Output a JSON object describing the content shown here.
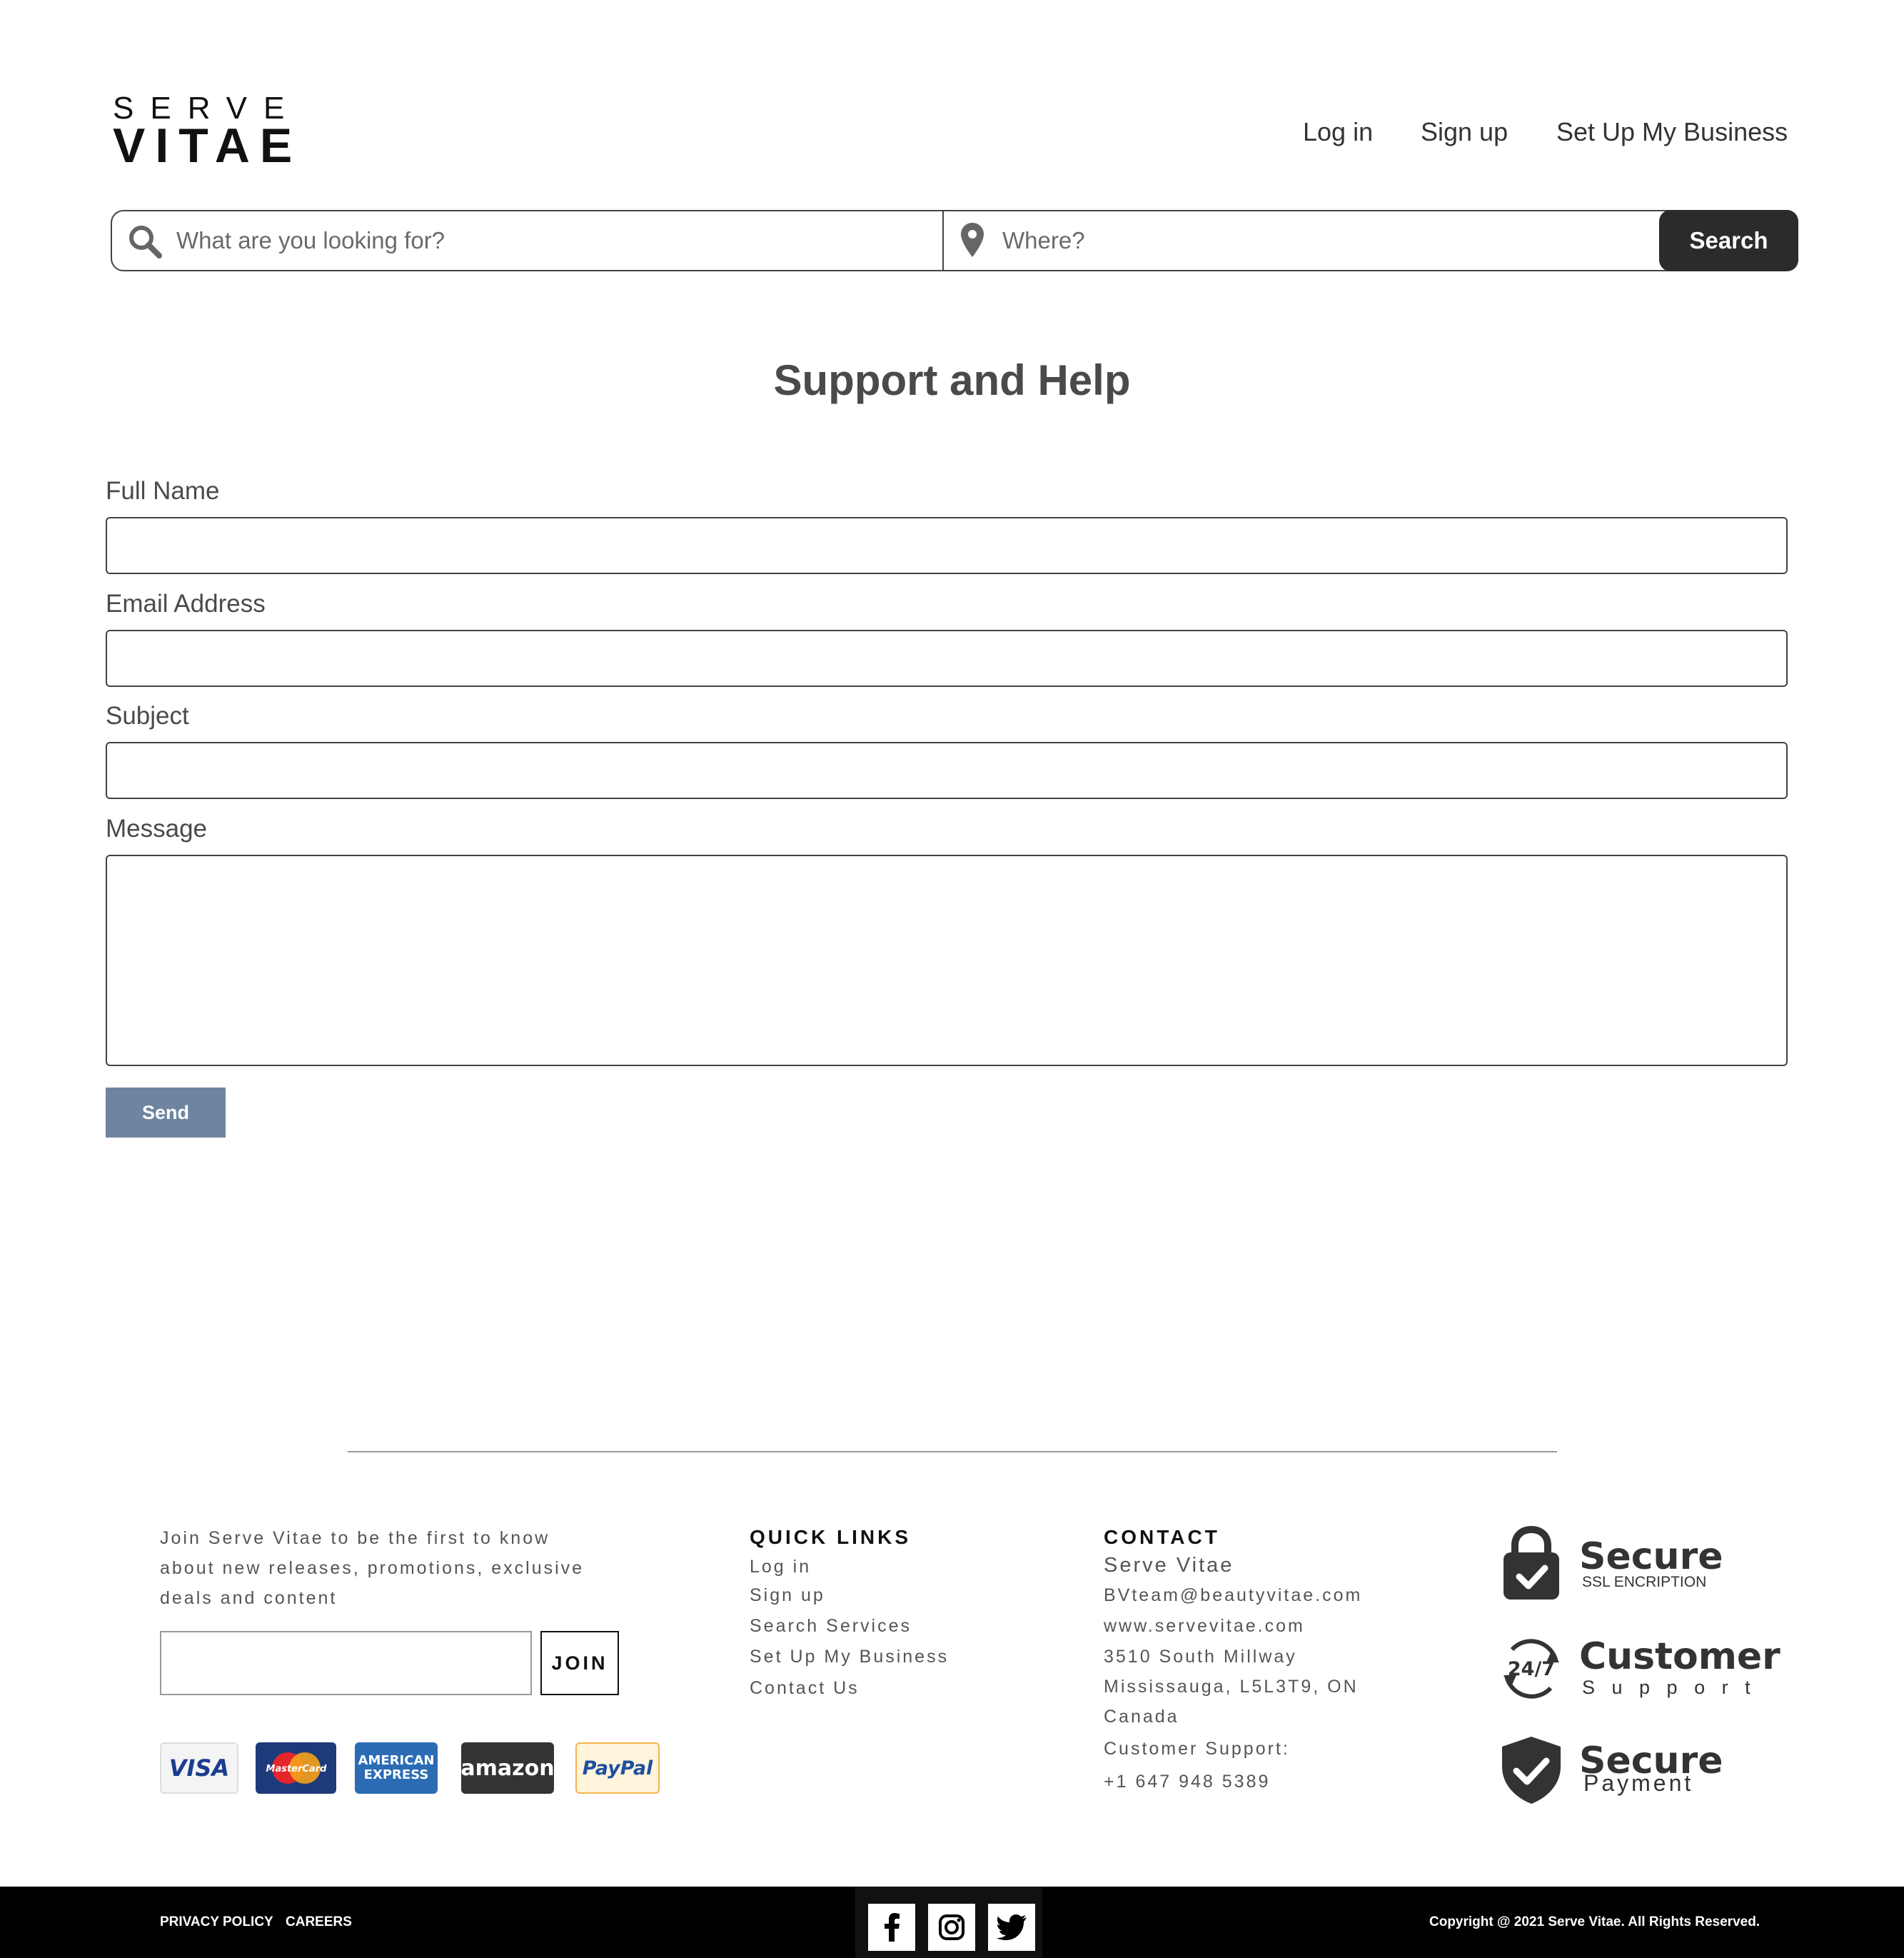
{
  "header": {
    "logo_top": "SERVE",
    "logo_bottom": "VITAE",
    "nav": {
      "login": "Log in",
      "signup": "Sign up",
      "business": "Set Up My Business"
    }
  },
  "search": {
    "what_placeholder": "What are you looking for?",
    "where_placeholder": "Where?",
    "button": "Search"
  },
  "page_title": "Support and Help",
  "form": {
    "full_name_label": "Full Name",
    "full_name_value": "",
    "email_label": "Email Address",
    "email_value": "",
    "subject_label": "Subject",
    "subject_value": "",
    "message_label": "Message",
    "message_value": "",
    "send_button": "Send"
  },
  "footer": {
    "newsletter_lines": [
      "Join Serve Vitae to be the first to know",
      "about new releases, promotions, exclusive",
      "deals and content"
    ],
    "join_button": "JOIN",
    "payments": {
      "visa": "VISA",
      "mastercard": "MasterCard",
      "amex_line1": "AMERICAN",
      "amex_line2": "EXPRESS",
      "amazon": "amazon",
      "paypal": "PayPal"
    },
    "quick_links_heading": "QUICK LINKS",
    "quick_links": [
      "Log in",
      "Sign up",
      "Search Services",
      "Set Up My Business",
      "Contact Us"
    ],
    "contact_heading": "CONTACT",
    "contact": {
      "name": "Serve Vitae",
      "email": "BVteam@beautyvitae.com",
      "website": "www.servevitae.com",
      "address1": "3510 South Millway",
      "address2": "Mississauga, L5L3T9, ON",
      "country": "Canada",
      "support_label": "Customer Support:",
      "phone": "+1 647 948 5389"
    },
    "badges": {
      "ssl_title": "Secure",
      "ssl_sub": "SSL ENCRIPTION",
      "support_icon_text": "24/7",
      "support_title": "Customer",
      "support_sub": "S u p p o r t",
      "payment_title": "Secure",
      "payment_sub": "Payment"
    }
  },
  "bottom_bar": {
    "privacy": "PRIVACY POLICY",
    "careers": "CAREERS",
    "copyright": "Copyright @ 2021 Serve Vitae. All Rights Reserved."
  },
  "colors": {
    "send_button": "#6f859f",
    "search_button": "#2b2b2b",
    "bottom_bar": "#000000"
  }
}
